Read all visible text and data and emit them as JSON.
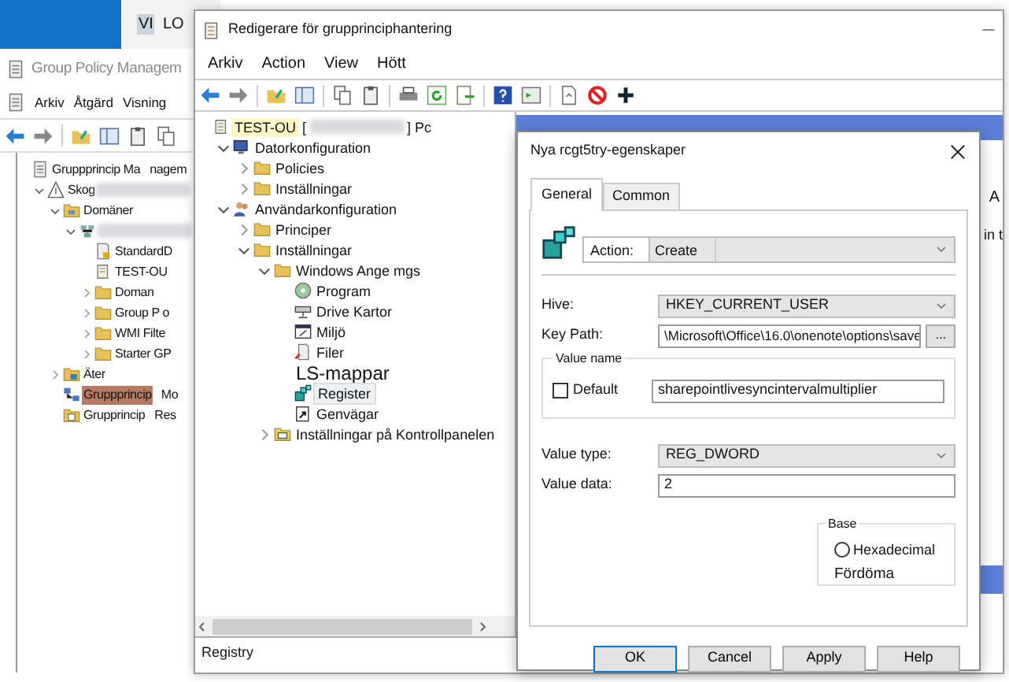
{
  "back_window": {
    "tab_texts": [
      {
        "text": "VI",
        "selected": true
      },
      {
        "text": "LO",
        "selected": false
      }
    ],
    "title": "Group Policy Managem",
    "menu": [
      "Arkiv",
      "Åtgärd",
      "Visning"
    ],
    "tree": [
      {
        "label": "Gruppprincip Ma",
        "suffix": "nagem",
        "kind": "console",
        "children": [
          {
            "label": "Skog",
            "kind": "forest",
            "redacted": true,
            "expanded": true,
            "children": [
              {
                "label": "Domäner",
                "kind": "domainfolder",
                "expanded": true,
                "children": [
                  {
                    "kind": "domain",
                    "redacted": true,
                    "expanded": true,
                    "children": [
                      {
                        "label": "StandardD",
                        "kind": "gpolink"
                      },
                      {
                        "label": "TEST-OU",
                        "kind": "ou"
                      },
                      {
                        "label": "Doman",
                        "kind": "folder",
                        "expanded": false
                      },
                      {
                        "label": "Group P o",
                        "kind": "folder",
                        "expanded": false
                      },
                      {
                        "label": "WMI Filte",
                        "kind": "folder",
                        "expanded": false
                      },
                      {
                        "label": "Starter GP",
                        "kind": "folder",
                        "expanded": false
                      }
                    ]
                  }
                ]
              },
              {
                "label": "Äter",
                "kind": "site",
                "expanded": false
              },
              {
                "label": "Gruppprincip",
                "suffix": "Mo",
                "kind": "modeling",
                "selected": true
              },
              {
                "label": "Grupprincip",
                "suffix": "Res",
                "kind": "results",
                "selected": false
              }
            ]
          }
        ]
      }
    ]
  },
  "editor": {
    "title": "Redigerare för grupprinciphantering",
    "menu": [
      "Arkiv",
      "Action",
      "View",
      "Hött"
    ],
    "tree": [
      {
        "label": "TEST-OU",
        "prefix": "[",
        "suffix": "] Pc",
        "kind": "gpo",
        "redacted": true,
        "children": [
          {
            "label": "Datorkonfiguration",
            "kind": "computer",
            "expanded": true,
            "children": [
              {
                "label": "Policies",
                "kind": "folder",
                "expanded": false
              },
              {
                "label": "Inställningar",
                "kind": "folder",
                "expanded": false
              }
            ]
          },
          {
            "label": "Användarkonfiguration",
            "kind": "user",
            "expanded": true,
            "children": [
              {
                "label": "Principer",
                "kind": "folder",
                "expanded": false
              },
              {
                "label": "Inställningar",
                "kind": "folder",
                "expanded": true,
                "children": [
                  {
                    "label": "Windows Ange mgs",
                    "kind": "folder",
                    "expanded": true,
                    "children": [
                      {
                        "label": "Program",
                        "kind": "app"
                      },
                      {
                        "label": "Drive Kartor",
                        "kind": "drive"
                      },
                      {
                        "label": "Miljö",
                        "kind": "env"
                      },
                      {
                        "label": "Filer",
                        "kind": "files"
                      },
                      {
                        "label": "LS-mappar",
                        "kind": "none"
                      },
                      {
                        "label": "Register",
                        "kind": "registry",
                        "selected": true
                      },
                      {
                        "label": "Genvägar",
                        "kind": "shortcut",
                        "selected": false
                      }
                    ]
                  },
                  {
                    "label": "Inställningar på Kontrollpanelen",
                    "kind": "panel",
                    "expanded": false
                  }
                ]
              }
            ]
          }
        ]
      }
    ],
    "right_texts": [
      "A",
      "in t"
    ],
    "status": "Registry"
  },
  "dialog": {
    "title": "Nya rcgt5try-egenskaper",
    "tabs": [
      {
        "label": "General",
        "selected": true
      },
      {
        "label": "Common",
        "selected": false
      }
    ],
    "action": {
      "label": "Action:",
      "value": "Create"
    },
    "hive": {
      "label": "Hive:",
      "value": "HKEY_CURRENT_USER"
    },
    "key_path": {
      "label": "Key Path:",
      "value": "\\Microsoft\\Office\\16.0\\onenote\\options\\save",
      "button": "..."
    },
    "value_name": {
      "legend": "Value name",
      "default_label": "Default",
      "default_checked": false,
      "value": "sharepointlivesyncintervalmultiplier"
    },
    "value_type": {
      "label": "Value type:",
      "value": "REG_DWORD"
    },
    "value_data": {
      "label": "Value data:",
      "value": "2"
    },
    "base": {
      "legend": "Base",
      "options": [
        {
          "label": "Hexadecimal",
          "selected": false
        }
      ],
      "note": "Fördöma"
    },
    "buttons": [
      {
        "label": "OK",
        "default": true
      },
      {
        "label": "Cancel",
        "default": false
      },
      {
        "label": "Apply",
        "default": false
      },
      {
        "label": "Help",
        "default": false
      }
    ]
  }
}
